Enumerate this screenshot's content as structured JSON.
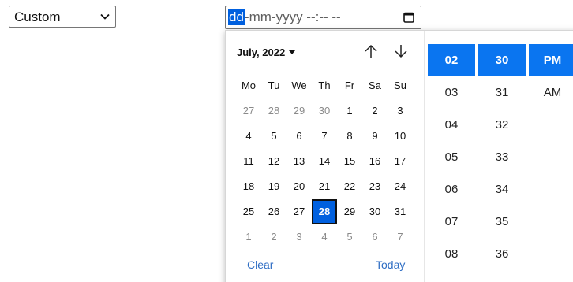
{
  "select": {
    "value": "Custom"
  },
  "datetime_input": {
    "active_segment": "dd",
    "rest": "-mm-yyyy --:-- --"
  },
  "calendar": {
    "month_label": "July, 2022",
    "weekdays": [
      "Mo",
      "Tu",
      "We",
      "Th",
      "Fr",
      "Sa",
      "Su"
    ],
    "weeks": [
      [
        "27",
        "28",
        "29",
        "30",
        "1",
        "2",
        "3"
      ],
      [
        "4",
        "5",
        "6",
        "7",
        "8",
        "9",
        "10"
      ],
      [
        "11",
        "12",
        "13",
        "14",
        "15",
        "16",
        "17"
      ],
      [
        "18",
        "19",
        "20",
        "21",
        "22",
        "23",
        "24"
      ],
      [
        "25",
        "26",
        "27",
        "28",
        "29",
        "30",
        "31"
      ],
      [
        "1",
        "2",
        "3",
        "4",
        "5",
        "6",
        "7"
      ]
    ],
    "selected_day": "28",
    "clear_label": "Clear",
    "today_label": "Today"
  },
  "time": {
    "hours": [
      "02",
      "03",
      "04",
      "05",
      "06",
      "07",
      "08"
    ],
    "minutes": [
      "30",
      "31",
      "32",
      "33",
      "34",
      "35",
      "36"
    ],
    "ampm": [
      "PM",
      "AM"
    ],
    "selected_hour": "02",
    "selected_minute": "30",
    "selected_ampm": "PM"
  },
  "icons": {
    "select_chevron": "chevron-down-icon",
    "input_calendar": "calendar-icon",
    "month_dropdown": "caret-down-icon",
    "nav_prev": "arrow-up-icon",
    "nav_next": "arrow-down-icon"
  },
  "colors": {
    "accent": "#0060df",
    "time_selected": "#0a75f0",
    "link": "#2f6ec4",
    "muted_day": "#8a8a8a"
  }
}
